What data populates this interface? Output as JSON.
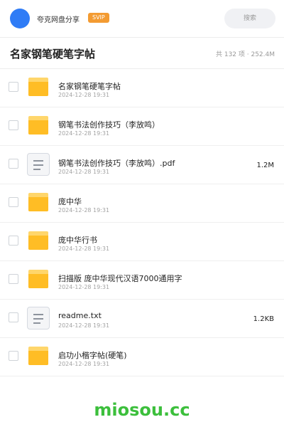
{
  "header": {
    "username": "夸克网盘分享",
    "badge": "SVIP",
    "search_placeholder": "搜索"
  },
  "folder": {
    "title": "名家钢笔硬笔字帖",
    "meta": "共 132 项 · 252.4M"
  },
  "files": [
    {
      "type": "folder-icon",
      "name": "名家钢笔硬笔字帖",
      "date": "2024-12-28 19:31",
      "size": ""
    },
    {
      "type": "folder-icon",
      "name": "钢笔书法创作技巧（李放鸣）",
      "date": "2024-12-28 19:31",
      "size": ""
    },
    {
      "type": "document-icon",
      "name": "钢笔书法创作技巧（李放鸣）.pdf",
      "date": "2024-12-28 19:31",
      "size": "1.2M"
    },
    {
      "type": "folder-icon",
      "name": "庞中华",
      "date": "2024-12-28 19:31",
      "size": ""
    },
    {
      "type": "folder-icon",
      "name": "庞中华行书",
      "date": "2024-12-28 19:31",
      "size": ""
    },
    {
      "type": "folder-icon",
      "name": "扫描版 庞中华现代汉语7000通用字",
      "date": "2024-12-28 19:31",
      "size": ""
    },
    {
      "type": "document-icon",
      "name": "readme.txt",
      "date": "2024-12-28 19:31",
      "size": "1.2KB"
    },
    {
      "type": "folder-icon",
      "name": "启功小楷字帖(硬笔)",
      "date": "2024-12-28 19:31",
      "size": ""
    }
  ],
  "watermark": "miosou.cc",
  "colors": {
    "avatar": "#2f7cf6",
    "badge": "#f39b32",
    "folder": "#ffbd25",
    "watermark": "#3cbf3c"
  }
}
